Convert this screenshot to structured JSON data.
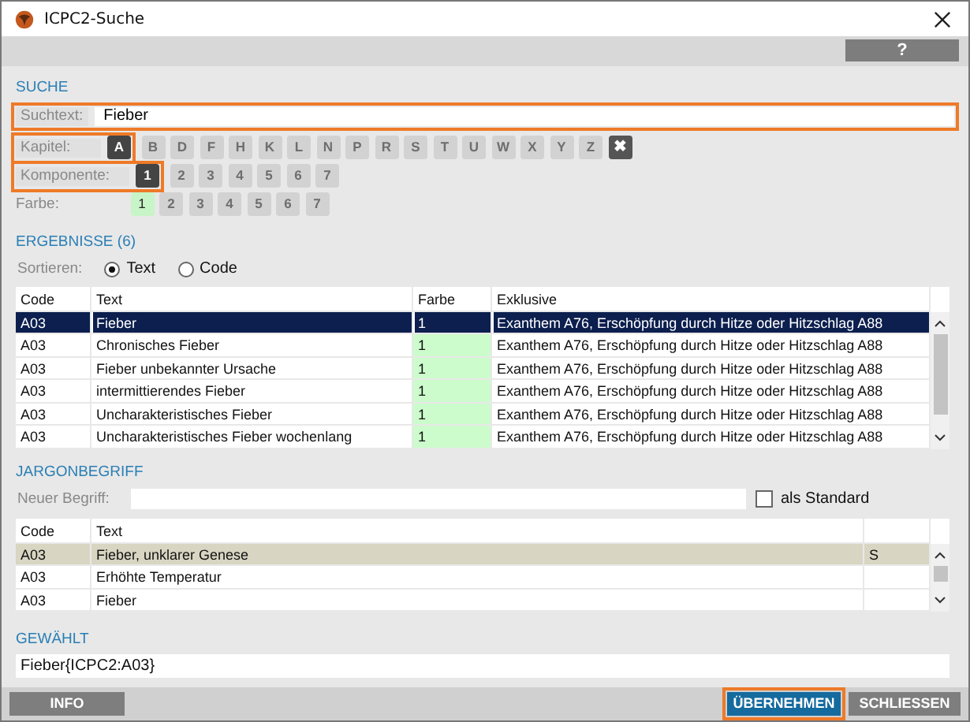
{
  "window": {
    "title": "ICPC2-Suche"
  },
  "toolbar": {
    "help_button": "?"
  },
  "search": {
    "heading": "SUCHE",
    "label": "Suchtext:",
    "value": "Fieber",
    "highlighted": true,
    "kapitel": {
      "label": "Kapitel:",
      "highlighted": true,
      "clear": "✖",
      "items": [
        {
          "label": "A",
          "selected": true
        },
        {
          "label": "B",
          "selected": false
        },
        {
          "label": "D",
          "selected": false
        },
        {
          "label": "F",
          "selected": false
        },
        {
          "label": "H",
          "selected": false
        },
        {
          "label": "K",
          "selected": false
        },
        {
          "label": "L",
          "selected": false
        },
        {
          "label": "N",
          "selected": false
        },
        {
          "label": "P",
          "selected": false
        },
        {
          "label": "R",
          "selected": false
        },
        {
          "label": "S",
          "selected": false
        },
        {
          "label": "T",
          "selected": false
        },
        {
          "label": "U",
          "selected": false
        },
        {
          "label": "W",
          "selected": false
        },
        {
          "label": "X",
          "selected": false
        },
        {
          "label": "Y",
          "selected": false
        },
        {
          "label": "Z",
          "selected": false
        }
      ]
    },
    "komponente": {
      "label": "Komponente:",
      "highlighted": true,
      "items": [
        {
          "label": "1",
          "selected": true
        },
        {
          "label": "2",
          "selected": false
        },
        {
          "label": "3",
          "selected": false
        },
        {
          "label": "4",
          "selected": false
        },
        {
          "label": "5",
          "selected": false
        },
        {
          "label": "6",
          "selected": false
        },
        {
          "label": "7",
          "selected": false
        }
      ]
    },
    "farbe": {
      "label": "Farbe:",
      "items": [
        {
          "label": "1",
          "selected": true
        },
        {
          "label": "2",
          "selected": false
        },
        {
          "label": "3",
          "selected": false
        },
        {
          "label": "4",
          "selected": false
        },
        {
          "label": "5",
          "selected": false
        },
        {
          "label": "6",
          "selected": false
        },
        {
          "label": "7",
          "selected": false
        }
      ]
    }
  },
  "results": {
    "heading": "ERGEBNISSE (6)",
    "sort_label": "Sortieren:",
    "sort_options": [
      {
        "label": "Text",
        "selected": true
      },
      {
        "label": "Code",
        "selected": false
      }
    ],
    "columns": [
      "Code",
      "Text",
      "Farbe",
      "Exklusive"
    ],
    "rows": [
      {
        "code": "A03",
        "text": "Fieber",
        "farbe": "1",
        "exklusive": "Exanthem A76, Erschöpfung durch Hitze oder Hitzschlag A88",
        "selected": true
      },
      {
        "code": "A03",
        "text": "Chronisches Fieber",
        "farbe": "1",
        "exklusive": "Exanthem A76, Erschöpfung durch Hitze oder Hitzschlag A88",
        "selected": false
      },
      {
        "code": "A03",
        "text": "Fieber unbekannter Ursache",
        "farbe": "1",
        "exklusive": "Exanthem A76, Erschöpfung durch Hitze oder Hitzschlag A88",
        "selected": false
      },
      {
        "code": "A03",
        "text": "intermittierendes Fieber",
        "farbe": "1",
        "exklusive": "Exanthem A76, Erschöpfung durch Hitze oder Hitzschlag A88",
        "selected": false
      },
      {
        "code": "A03",
        "text": "Uncharakteristisches Fieber",
        "farbe": "1",
        "exklusive": "Exanthem A76, Erschöpfung durch Hitze oder Hitzschlag A88",
        "selected": false
      },
      {
        "code": "A03",
        "text": "Uncharakteristisches Fieber wochenlang",
        "farbe": "1",
        "exklusive": "Exanthem A76, Erschöpfung durch Hitze oder Hitzschlag A88",
        "selected": false
      }
    ]
  },
  "jargon": {
    "heading": "JARGONBEGRIFF",
    "new_label": "Neuer Begriff:",
    "standard_label": "als Standard",
    "standard_checked": false,
    "columns": [
      "Code",
      "Text"
    ],
    "rows": [
      {
        "code": "A03",
        "text": "Fieber, unklarer Genese",
        "column_3": "S",
        "selected": true
      },
      {
        "code": "A03",
        "text": "Erhöhte Temperatur",
        "selected": false
      },
      {
        "code": "A03",
        "text": "Fieber",
        "selected": false
      }
    ]
  },
  "chosen": {
    "heading": "GEWÄHLT",
    "value": "Fieber{ICPC2:A03}"
  },
  "buttons": [
    {
      "label": "INFO",
      "kind": "plain",
      "highlighted": false
    },
    {
      "label": "ÜBERNEHMEN",
      "kind": "primary",
      "highlighted": true
    },
    {
      "label": "SCHLIESSEN",
      "kind": "plain",
      "highlighted": false
    }
  ]
}
